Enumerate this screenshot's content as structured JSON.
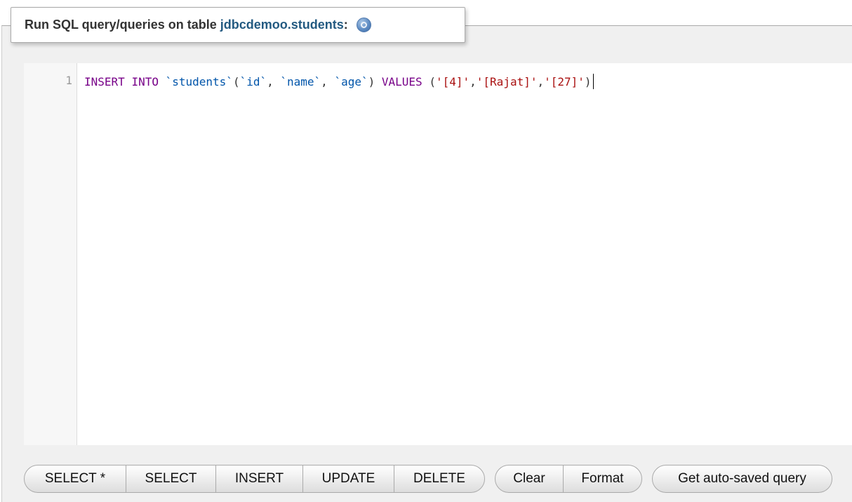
{
  "legend": {
    "prefix": "Run SQL query/queries on table ",
    "table": "jdbcdemoo.students",
    "colon": ":",
    "help_icon": "help-circle-icon"
  },
  "editor": {
    "line_number": "1",
    "tokens": {
      "insert": "INSERT",
      "into": "INTO",
      "table": "`students`",
      "open_paren": "(",
      "col_id": "`id`",
      "comma1": ", ",
      "col_name": "`name`",
      "comma2": ", ",
      "col_age": "`age`",
      "close_paren": ")",
      "values": "VALUES",
      "open_paren2": "(",
      "val1": "'[4]'",
      "comma3": ",",
      "val2": "'[Rajat]'",
      "comma4": ",",
      "val3": "'[27]'",
      "close_paren2": ")"
    }
  },
  "buttons": {
    "select_star": "SELECT *",
    "select": "SELECT",
    "insert": "INSERT",
    "update": "UPDATE",
    "delete": "DELETE",
    "clear": "Clear",
    "format": "Format",
    "get_auto_saved": "Get auto-saved query"
  },
  "colors": {
    "keyword": "#770088",
    "identifier": "#0055aa",
    "string": "#aa1111",
    "table_link": "#235a81"
  }
}
